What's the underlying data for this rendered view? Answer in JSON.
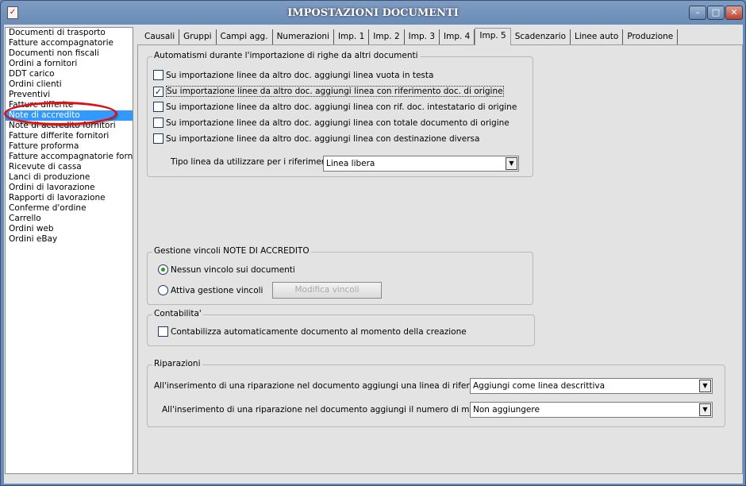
{
  "window": {
    "title": "IMPOSTAZIONI DOCUMENTI",
    "minimize": "–",
    "maximize": "□",
    "close": "✕"
  },
  "sidebar": {
    "items": [
      "Documenti di trasporto",
      "Fatture accompagnatorie",
      "Documenti non fiscali",
      "Ordini a fornitori",
      "DDT carico",
      "Ordini clienti",
      "Preventivi",
      "Fatture differite",
      "Note di accredito",
      "Note di accredito fornitori",
      "Fatture differite fornitori",
      "Fatture proforma",
      "Fatture accompagnatorie fornitori",
      "Ricevute di cassa",
      "Lanci di produzione",
      "Ordini di lavorazione",
      "Rapporti di lavorazione",
      "Conferme d'ordine",
      "Carrello",
      "Ordini web",
      "Ordini eBay"
    ],
    "selected": "Note di accredito"
  },
  "tabs": [
    "Causali",
    "Gruppi",
    "Campi agg.",
    "Numerazioni",
    "Imp. 1",
    "Imp. 2",
    "Imp. 3",
    "Imp. 4",
    "Imp. 5",
    "Scadenzario",
    "Linee auto",
    "Produzione"
  ],
  "active_tab": "Imp. 5",
  "automatismi": {
    "legend": "Automatismi durante l'importazione di righe da altri documenti",
    "options": [
      {
        "label": "Su importazione linee da altro doc. aggiungi linea vuota in testa",
        "checked": false
      },
      {
        "label": "Su importazione linee da altro doc. aggiungi linea con riferimento doc. di origine",
        "checked": true
      },
      {
        "label": "Su importazione linee da altro doc. aggiungi linea con rif. doc. intestatario di origine",
        "checked": false
      },
      {
        "label": "Su importazione linee da altro doc. aggiungi linea con totale documento di origine",
        "checked": false
      },
      {
        "label": "Su importazione linee da altro doc. aggiungi linea con destinazione diversa",
        "checked": false
      }
    ],
    "tipo_label": "Tipo linea da utilizzare per i riferimenti :",
    "tipo_value": "Linea libera"
  },
  "vincoli": {
    "legend": "Gestione vincoli NOTE DI ACCREDITO",
    "radio1": "Nessun vincolo sui documenti",
    "radio2": "Attiva gestione vincoli",
    "button": "Modifica vincoli"
  },
  "contabilita": {
    "legend": "Contabilita'",
    "option": "Contabilizza automaticamente documento al momento della creazione"
  },
  "riparazioni": {
    "legend": "Riparazioni",
    "row1_label": "All'inserimento di una riparazione nel documento aggiungi una linea di riferimento :",
    "row1_value": "Aggiungi come linea descrittiva",
    "row2_label": "All'inserimento di una riparazione nel documento aggiungi il numero di matricola :",
    "row2_value": "Non aggiungere"
  }
}
